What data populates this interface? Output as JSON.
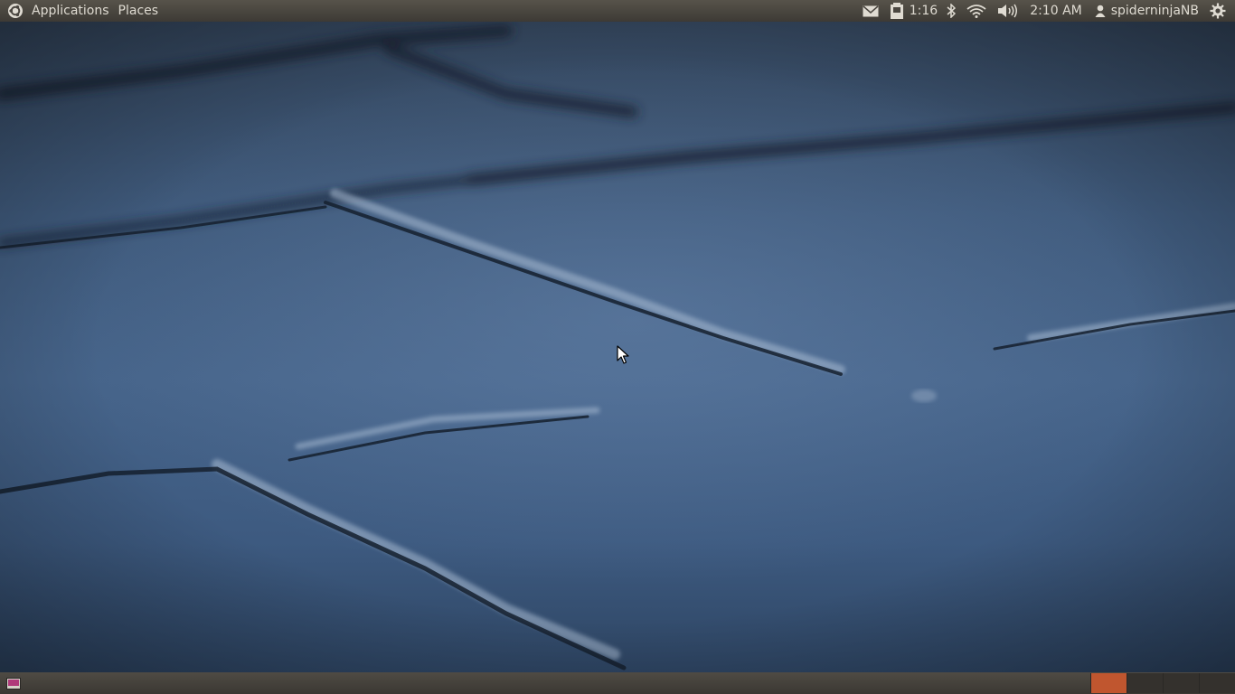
{
  "top_panel": {
    "menus": {
      "applications": "Applications",
      "places": "Places"
    },
    "battery_time": "1:16",
    "clock": "2:10 AM",
    "username": "spiderninjaNB"
  },
  "icons": {
    "ubuntu_logo": "ubuntu-logo-icon",
    "mail": "mail-icon",
    "battery": "battery-icon",
    "bluetooth": "bluetooth-icon",
    "wifi": "wifi-icon",
    "volume": "volume-icon",
    "user": "user-icon",
    "power": "power-icon",
    "show_desktop": "show-desktop-icon"
  },
  "workspaces": [
    {
      "active": true
    },
    {
      "active": false
    },
    {
      "active": false
    },
    {
      "active": false
    }
  ],
  "colors": {
    "panel": "#3d3a35",
    "panel_text": "#dfdbd2",
    "active_workspace": "#c0562f",
    "wallpaper": "#46648a"
  }
}
